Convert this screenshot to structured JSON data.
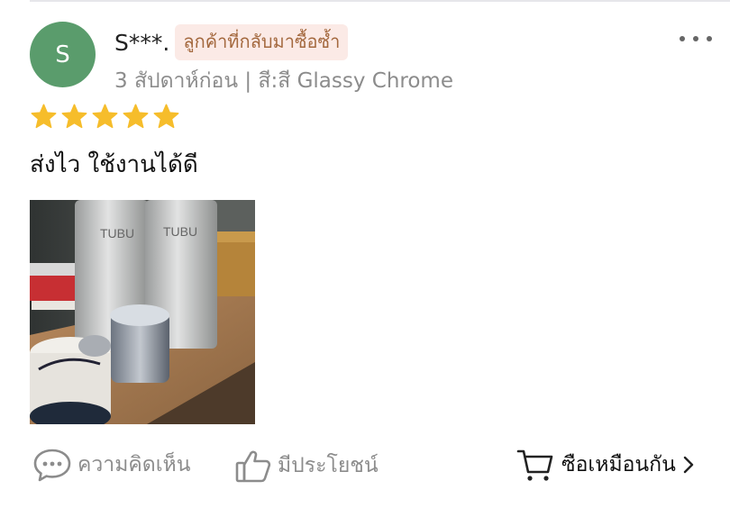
{
  "review": {
    "avatar_letter": "S",
    "username": "S***.",
    "badge": "ลูกค้าที่กลับมาซื้อซ้ำ",
    "meta": "3 สัปดาห์ก่อน | สี:สี Glassy Chrome",
    "rating": 5,
    "text": "ส่งไว ใช้งานได้ดี",
    "photo_label": "TUBU"
  },
  "actions": {
    "comment_label": "ความคิดเห็น",
    "helpful_label": "มีประโยชน์",
    "buy_label": "ซือเหมือนกัน"
  },
  "colors": {
    "avatar": "#5a9c6c",
    "star": "#f6bd2b",
    "badge_bg": "#fbeae6",
    "badge_text": "#a4693f",
    "muted": "#8c8c8c"
  },
  "icons": {
    "more": "more-horizontal-icon",
    "star": "star-icon",
    "comment": "chat-bubble-icon",
    "helpful": "thumbs-up-icon",
    "cart": "cart-icon",
    "chevron": "chevron-right-icon"
  }
}
